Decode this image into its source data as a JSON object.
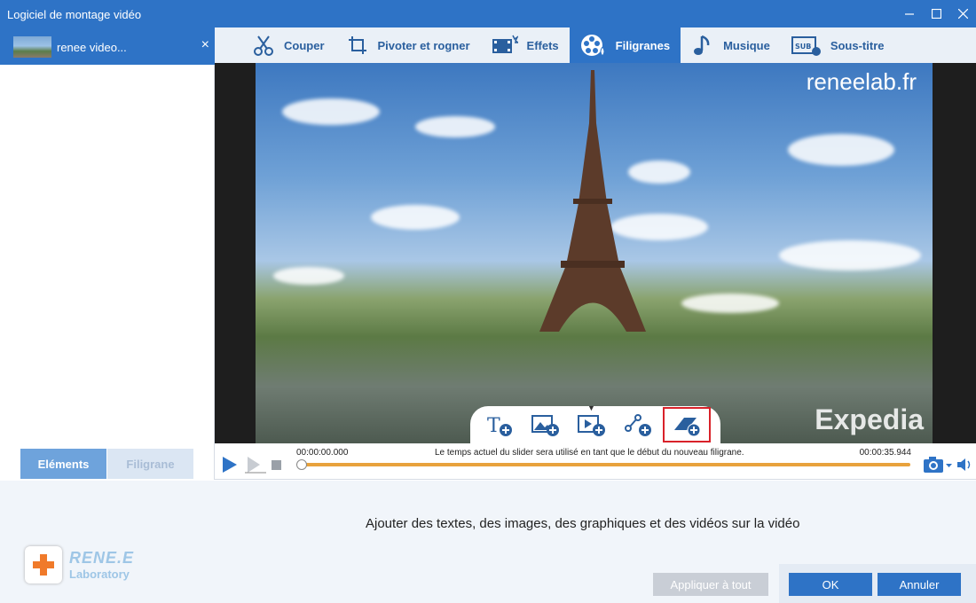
{
  "window": {
    "title": "Logiciel de montage vidéo"
  },
  "file": {
    "name": "renee video...",
    "close": "×"
  },
  "toolbar": [
    {
      "label": "Couper",
      "icon": "scissors-icon"
    },
    {
      "label": "Pivoter et rogner",
      "icon": "crop-rotate-icon"
    },
    {
      "label": "Effets",
      "icon": "effects-film-icon"
    },
    {
      "label": "Filigranes",
      "icon": "watermark-film-reel-icon",
      "active": true
    },
    {
      "label": "Musique",
      "icon": "music-note-icon"
    },
    {
      "label": "Sous-titre",
      "icon": "subtitle-icon"
    }
  ],
  "preview": {
    "watermark": "reneelab.fr",
    "overlay_logo": "Expedia"
  },
  "add_buttons": [
    "add-text-icon",
    "add-image-icon",
    "add-video-icon",
    "add-shape-icon",
    "add-watermark-icon"
  ],
  "player": {
    "time_start": "00:00:00.000",
    "time_end": "00:00:35.944",
    "slider_message": "Le temps actuel du slider sera utilisé en tant que le début du nouveau filigrane."
  },
  "side_tabs": {
    "elements": "Eléments",
    "filigrane": "Filigrane"
  },
  "hint": "Ajouter des textes, des images, des graphiques et des vidéos sur la vidéo",
  "logo": {
    "line1": "RENE.E",
    "line2": "Laboratory"
  },
  "buttons": {
    "apply_all": "Appliquer à tout",
    "ok": "OK",
    "cancel": "Annuler"
  },
  "colors": {
    "accent": "#2e73c6",
    "highlight": "#d9222a",
    "slider": "#e8a23c"
  }
}
